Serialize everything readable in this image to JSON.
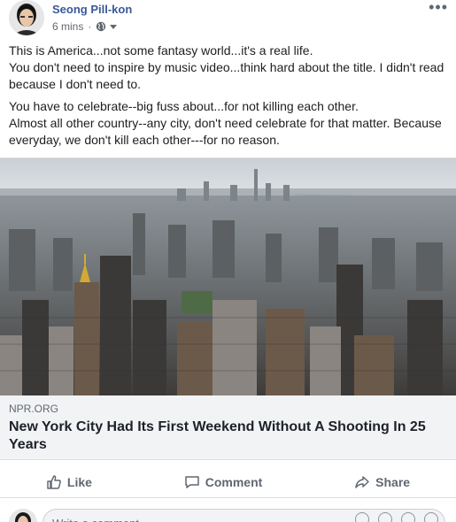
{
  "post": {
    "author": "Seong Pill-kon",
    "time": "6 mins",
    "meta_separator": "·",
    "more": "•••",
    "paragraphs": [
      "This is America...not some fantasy world...it's a real life.",
      "You don't need to inspire by music video...think hard about the title. I didn't read because I don't need to.",
      "You have to celebrate--big fuss about...for not killing each other.",
      "Almost all other country--any city, don't need celebrate for that matter. Because everyday, we don't kill each other---for no reason."
    ]
  },
  "link": {
    "source": "NPR.ORG",
    "title": "New York City Had Its First Weekend Without A Shooting In 25 Years"
  },
  "actions": {
    "like": "Like",
    "comment": "Comment",
    "share": "Share"
  },
  "comment_box": {
    "placeholder": "Write a comment..."
  },
  "colors": {
    "author_link": "#385898",
    "meta_text": "#616770",
    "action_text": "#606770"
  },
  "icons": {
    "privacy": "globe-icon",
    "privacy_menu": "caret-down-icon",
    "like": "thumbs-up-icon",
    "comment": "speech-bubble-icon",
    "share": "share-arrow-icon"
  }
}
